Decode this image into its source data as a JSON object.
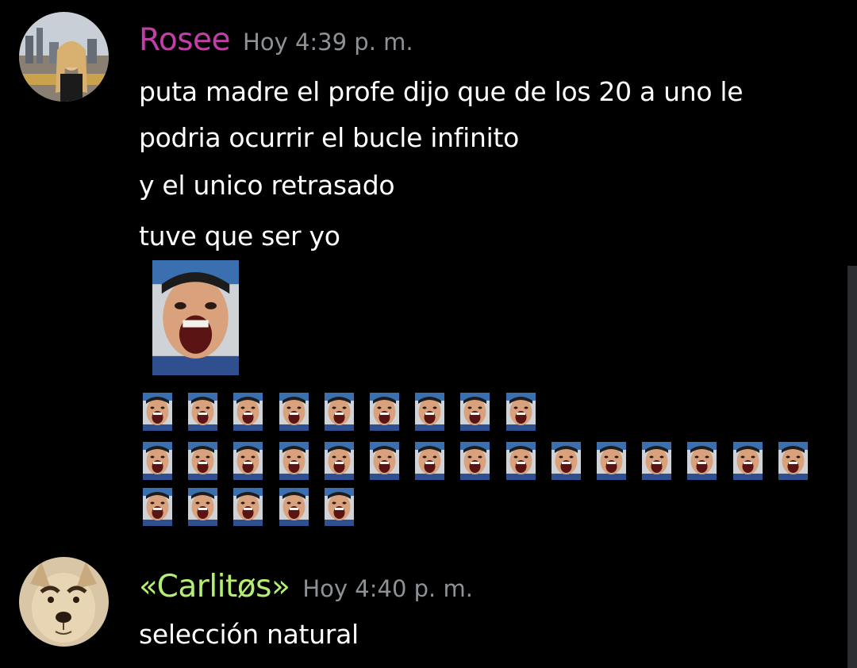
{
  "messages": [
    {
      "username": "Rosee",
      "username_color": "#c13fa6",
      "timestamp": "Hoy 4:39 p. m.",
      "lines": [
        "puta madre el profe dijo que de los 20 a uno le",
        "podria ocurrir el bucle infinito",
        "y el unico retrasado",
        "tuve que ser yo"
      ],
      "emoji_rows": [
        9,
        15,
        5
      ]
    },
    {
      "username": "«Carlitøs»",
      "username_color": "#b4ef73",
      "timestamp": "Hoy 4:40 p. m.",
      "lines": [
        "selección natural"
      ]
    }
  ],
  "colors": {
    "background": "#000000",
    "timestamp": "#8e9297",
    "text": "#ffffff",
    "scrollbar": "#2b2d31"
  },
  "icons": {
    "avatar_rosee": "woman-city-avatar",
    "avatar_carlitos": "dog-face-avatar",
    "emoji": "screaming-face-emoji"
  }
}
